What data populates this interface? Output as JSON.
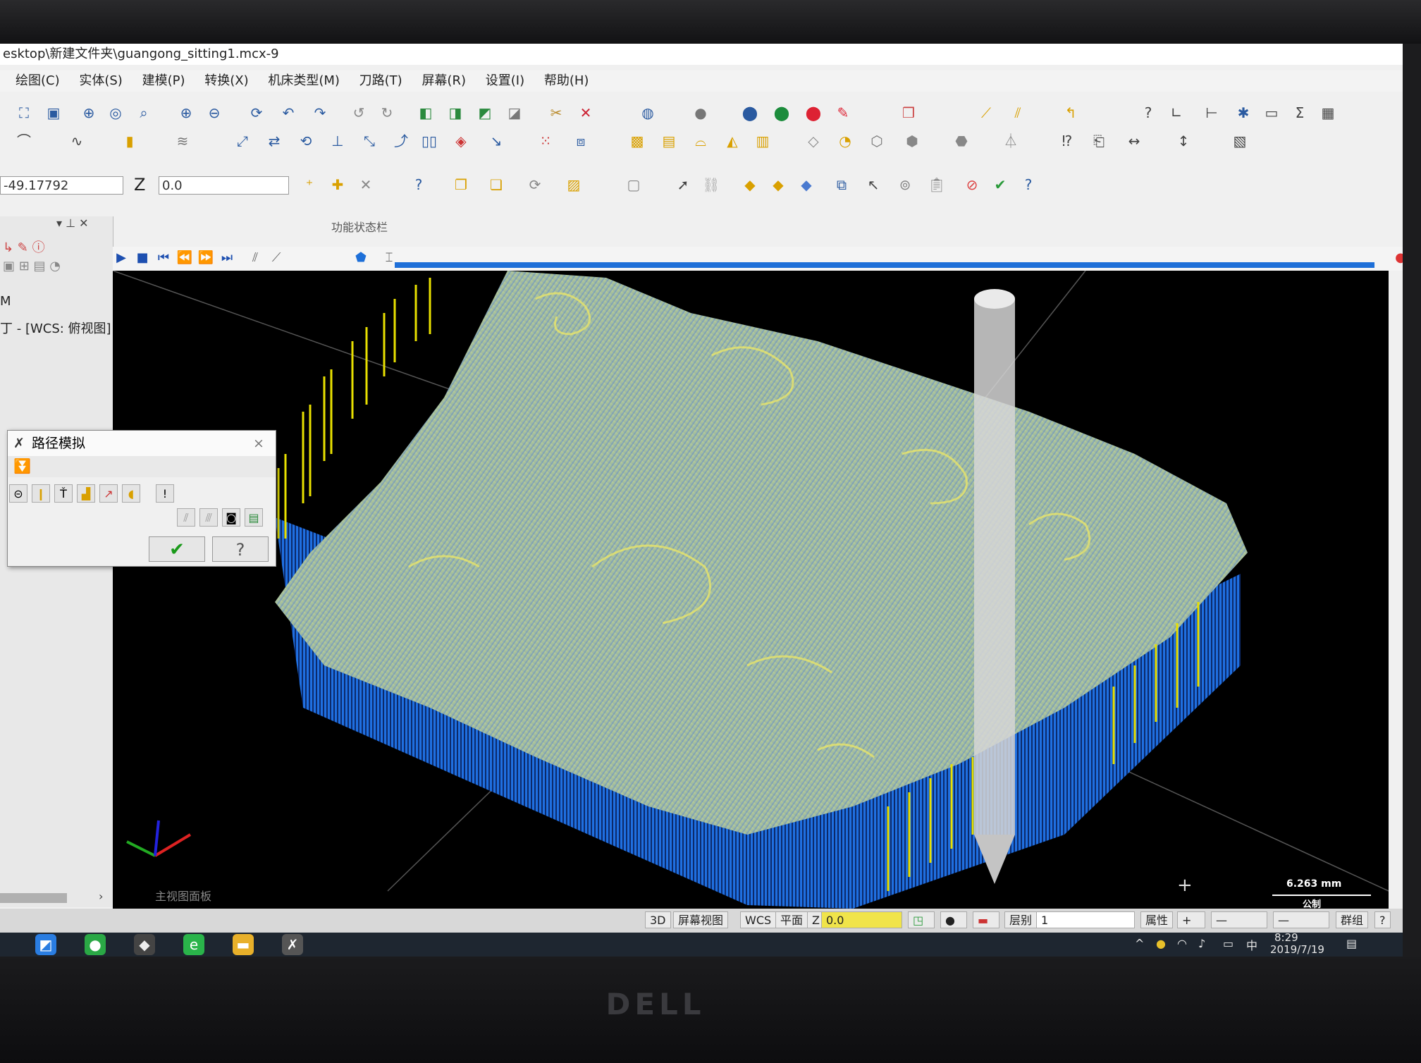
{
  "window": {
    "title": "esktop\\新建文件夹\\guangong_sitting1.mcx-9"
  },
  "menu": {
    "items": [
      "绘图(C)",
      "实体(S)",
      "建模(P)",
      "转换(X)",
      "机床类型(M)",
      "刀路(T)",
      "屏幕(R)",
      "设置(I)",
      "帮助(H)"
    ]
  },
  "coords": {
    "x_value": "-49.17792",
    "z_label": "Z",
    "z_value": "0.0"
  },
  "toolbar": {
    "status_label": "功能状态栏"
  },
  "left_panel": {
    "row_m": "M",
    "row_wcs": "丁 - [WCS: 俯视图] -"
  },
  "dialog": {
    "title": "路径模拟",
    "close": "×",
    "ok": "✔",
    "help": "?"
  },
  "viewport": {
    "scale_value": "6.263 mm",
    "scale_unit": "公制",
    "panel_label": "主视图面板"
  },
  "statusbar": {
    "mode_3d": "3D",
    "screen_view": "屏幕视图",
    "wcs": "WCS",
    "plane": "平面",
    "z_label": "Z",
    "z_value": "0.0",
    "level_label": "层别",
    "level_value": "1",
    "attributes": "属性",
    "group": "群组",
    "help": "?"
  },
  "taskbar": {
    "ime": "中",
    "time": "8:29",
    "date": "2019/7/19"
  },
  "colors": {
    "toolpath_yellow": "#e8e000",
    "toolpath_blue": "#1f6fe0",
    "surface_green": "#b7d29a",
    "tool_gray": "#d6d6d6"
  }
}
